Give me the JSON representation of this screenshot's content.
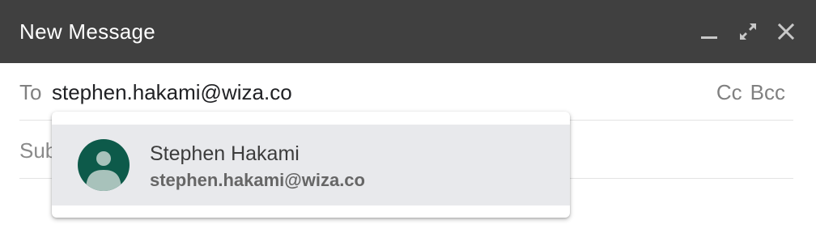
{
  "window": {
    "title": "New Message",
    "controls": {
      "minimize_icon": "minimize-icon",
      "maximize_icon": "expand-icon",
      "close_icon": "close-icon"
    }
  },
  "recipients": {
    "to_label": "To",
    "to_value": "stephen.hakami@wiza.co",
    "cc_label": "Cc",
    "bcc_label": "Bcc"
  },
  "subject": {
    "placeholder": "Subject",
    "value": ""
  },
  "suggestions": [
    {
      "name": "Stephen Hakami",
      "email": "stephen.hakami@wiza.co",
      "avatar_icon": "person-avatar-icon",
      "avatar_color": "#0d5a4a"
    }
  ],
  "colors": {
    "titlebar": "#404040",
    "suggestion_highlight": "#e8e9ec"
  }
}
